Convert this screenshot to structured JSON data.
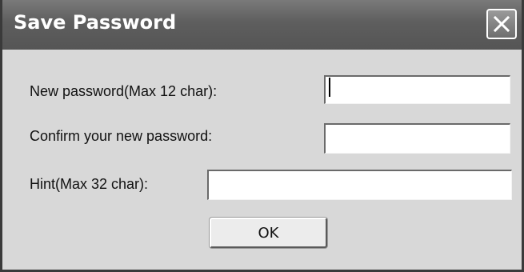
{
  "window": {
    "title": "Save Password",
    "close_icon": "close-icon"
  },
  "form": {
    "new_password_label": "New  password(Max 12 char):",
    "new_password_value": "",
    "confirm_password_label": "Confirm your new password:",
    "confirm_password_value": "",
    "hint_label": "Hint(Max 32 char):",
    "hint_value": ""
  },
  "buttons": {
    "ok_label": "OK"
  },
  "colors": {
    "titlebar": "#5e5e5e",
    "dialog_background": "#d8d8d8",
    "field_background": "#ffffff"
  }
}
